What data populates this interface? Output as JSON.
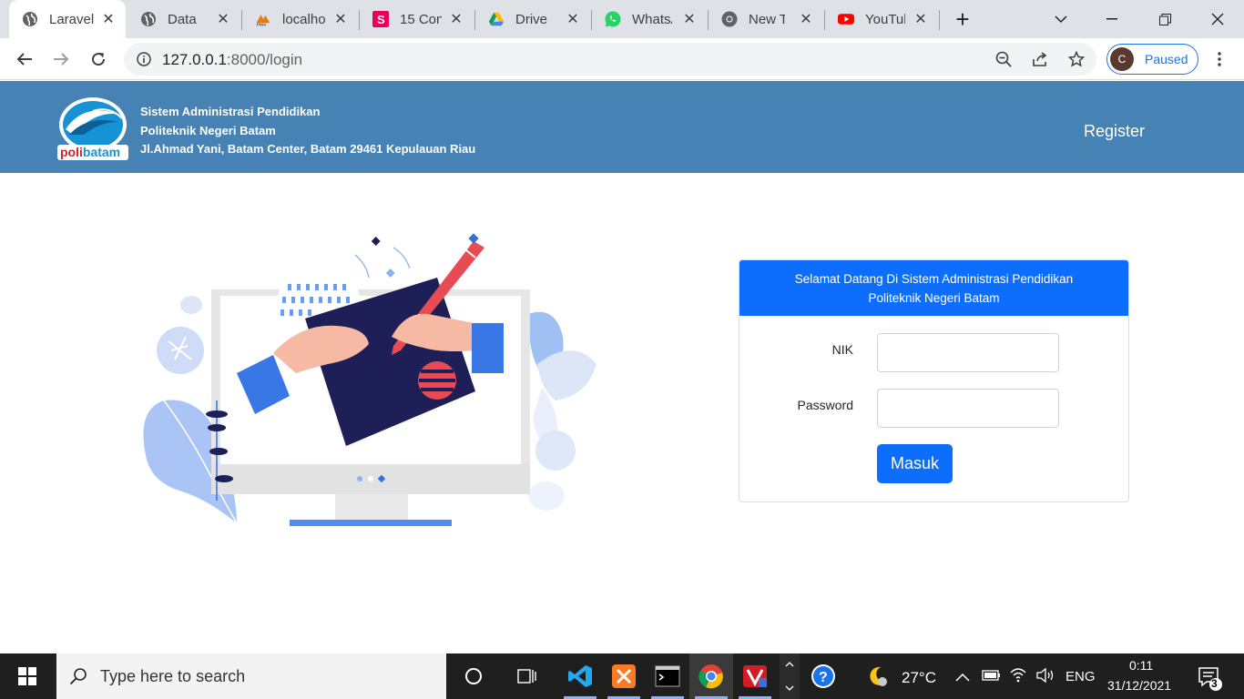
{
  "browser": {
    "tabs": [
      {
        "title": "Laravel",
        "icon": "globe-icon",
        "active": true
      },
      {
        "title": "Data D",
        "icon": "globe-icon"
      },
      {
        "title": "localho",
        "icon": "phpmyadmin-icon"
      },
      {
        "title": "15 Con",
        "icon": "s-brand-icon"
      },
      {
        "title": "Drive S",
        "icon": "google-drive-icon"
      },
      {
        "title": "WhatsA",
        "icon": "whatsapp-icon"
      },
      {
        "title": "New Ta",
        "icon": "chrome-icon"
      },
      {
        "title": "YouTub",
        "icon": "youtube-icon"
      }
    ],
    "url_host": "127.0.0.1",
    "url_path": ":8000/login",
    "profile_initial": "C",
    "profile_status": "Paused"
  },
  "header": {
    "line1": "Sistem Administrasi Pendidikan",
    "line2": "Politeknik Negeri Batam",
    "line3": "Jl.Ahmad Yani, Batam Center, Batam 29461 Kepulauan Riau",
    "logo_text_a": "poli",
    "logo_text_b": "batam",
    "register_label": "Register"
  },
  "login": {
    "title_line1": "Selamat Datang Di Sistem Administrasi Pendidikan",
    "title_line2": "Politeknik Negeri Batam",
    "nik_label": "NIK",
    "nik_value": "",
    "password_label": "Password",
    "password_value": "",
    "submit_label": "Masuk"
  },
  "taskbar": {
    "search_placeholder": "Type here to search",
    "weather": "27°C",
    "language": "ENG",
    "time": "0:11",
    "date": "31/12/2021",
    "notification_count": "3"
  },
  "colors": {
    "header_bg": "#4682b4",
    "primary": "#0d6efd",
    "tab_strip": "#dee1e6"
  }
}
